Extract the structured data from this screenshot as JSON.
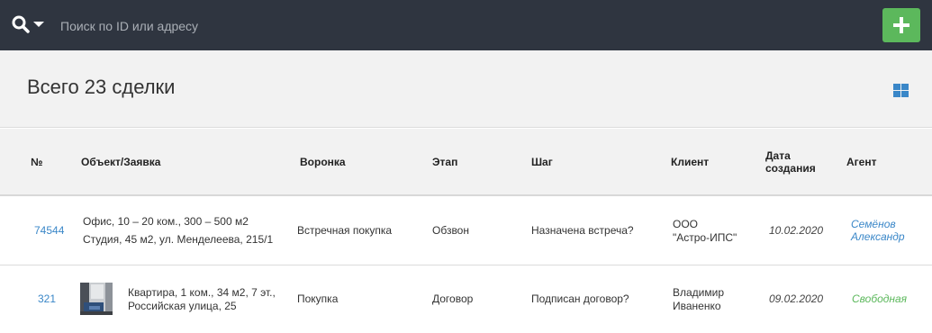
{
  "search": {
    "placeholder": "Поиск по ID или адресу"
  },
  "header": {
    "title": "Всего 23 сделки"
  },
  "colors": {
    "topbar": "#2f3540",
    "accent_green": "#5cb85c",
    "link_blue": "#3a87c8"
  },
  "icons": {
    "search": "search-icon",
    "dropdown": "caret-down-icon",
    "add": "plus-icon",
    "view": "grid-view-icon"
  },
  "table": {
    "columns": {
      "num": "№",
      "object": "Объект/Заявка",
      "funnel": "Воронка",
      "stage": "Этап",
      "step": "Шаг",
      "client": "Клиент",
      "date_line1": "Дата",
      "date_line2": "создания",
      "agent": "Агент"
    },
    "rows": [
      {
        "id": "74544",
        "object_line1": "Офис, 10 – 20 ком., 300 – 500 м2",
        "object_line2": "Студия, 45 м2, ул. Менделеева, 215/1",
        "funnel": "Встречная покупка",
        "stage": "Обзвон",
        "step": "Назначена встреча?",
        "client_line1": "ООО",
        "client_line2": "\"Астро-ИПС\"",
        "date": "10.02.2020",
        "agent_line1": "Семёнов",
        "agent_line2": "Александр"
      },
      {
        "id": "321",
        "object_line1": "Квартира, 1 ком., 34 м2, 7 эт.,",
        "object_line2": "Российская улица, 25",
        "funnel": "Покупка",
        "stage": "Договор",
        "step": "Подписан договор?",
        "client_line1": "Владимир",
        "client_line2": "Иваненко",
        "date": "09.02.2020",
        "agent": "Свободная"
      }
    ]
  }
}
